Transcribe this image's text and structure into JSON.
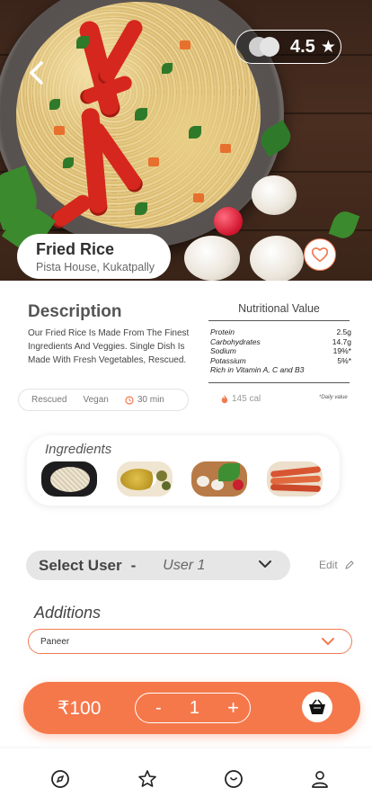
{
  "hero": {
    "rating": "4.5",
    "star_glyph": "★",
    "back_glyph": "‹",
    "dish_name": "Fried Rice",
    "restaurant": "Pista House, Kukatpally"
  },
  "description": {
    "title": "Description",
    "text": "Our Fried Rice Is Made From The Finest Ingredients And Veggies. Single Dish Is Made With Fresh Vegetables, Rescued.",
    "tags": [
      "Rescued",
      "Vegan"
    ],
    "time": "30 min"
  },
  "nutrition": {
    "title": "Nutritional Value",
    "rows": [
      {
        "name": "Protein",
        "value": "2.5g"
      },
      {
        "name": "Carbohydrates",
        "value": "14.7g"
      },
      {
        "name": "Sodium",
        "value": "19%*"
      },
      {
        "name": "Potassium",
        "value": "5%*"
      }
    ],
    "extra": "Rich in Vitamin A, C and B3",
    "calories": "145 cal",
    "daily_note": "*Daily value"
  },
  "ingredients": {
    "title": "Ingredients",
    "items": [
      "rice",
      "oil",
      "mushrooms-vegetables",
      "sausages"
    ]
  },
  "user_select": {
    "label": "Select User",
    "dash": "-",
    "value": "User 1",
    "edit_label": "Edit"
  },
  "additions": {
    "title": "Additions",
    "selected": "Paneer"
  },
  "order": {
    "price": "₹100",
    "minus": "-",
    "quantity": "1",
    "plus": "+"
  },
  "nav": {
    "items": [
      "compass-icon",
      "star-icon",
      "clock-icon",
      "user-icon"
    ]
  },
  "colors": {
    "accent": "#f5784b",
    "accent_border": "#f07b52"
  }
}
